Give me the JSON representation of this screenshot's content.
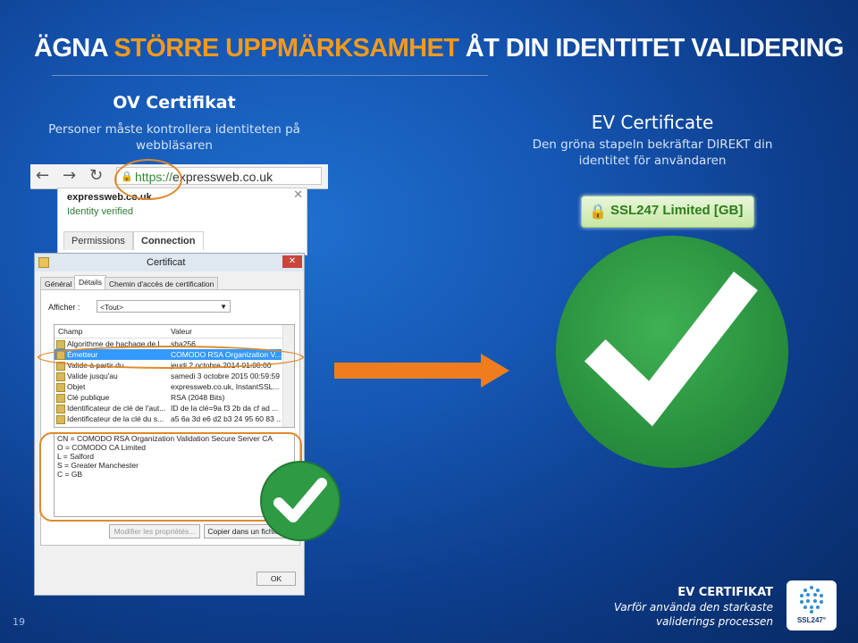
{
  "slide": {
    "title_part1": "ÄGNA ",
    "title_part2": "STÖRRE UPPMÄRKSAMHET",
    "title_part3": " ÅT DIN IDENTITET  VALIDERING",
    "page_number": "19"
  },
  "ov": {
    "title": "OV Certifikat",
    "subtitle": "Personer måste kontrollera identiteten på webbläsaren"
  },
  "ev": {
    "title": "EV Certificate",
    "subtitle": "Den gröna stapeln bekräftar DIREKT din identitet för användaren",
    "badge_text": "SSL247 Limited [GB]"
  },
  "browser": {
    "url_scheme": "https://",
    "url_host": "expressweb.co.uk",
    "popup_domain": "expressweb.co.uk",
    "popup_status": "Identity verified",
    "popup_tabs": [
      "Permissions",
      "Connection"
    ]
  },
  "certificate_dialog": {
    "title": "Certificat",
    "tabs": [
      "Général",
      "Détails",
      "Chemin d'accès de certification"
    ],
    "show_label": "Afficher :",
    "show_value": "<Tout>",
    "col_field": "Champ",
    "col_value": "Valeur",
    "rows": [
      {
        "field": "Algorithme de hachage de l...",
        "value": "sha256"
      },
      {
        "field": "Émetteur",
        "value": "COMODO RSA Organization V..."
      },
      {
        "field": "Valide à partir du",
        "value": "jeudi 2 octobre 2014 01:00:00"
      },
      {
        "field": "Valide jusqu'au",
        "value": "samedi 3 octobre 2015 00:59:59"
      },
      {
        "field": "Objet",
        "value": "expressweb.co.uk, InstantSSL..."
      },
      {
        "field": "Clé publique",
        "value": "RSA (2048 Bits)"
      },
      {
        "field": "Identificateur de clé de l'aut...",
        "value": "ID de la clé=9a f3 2b da cf ad ..."
      },
      {
        "field": "Identificateur de la clé du s...",
        "value": "a5 6a 3d e6 d2 b3 24 95 60 83 ..."
      }
    ],
    "detail_lines": [
      "CN = COMODO RSA Organization Validation Secure Server CA",
      "O = COMODO CA Limited",
      "L = Salford",
      "S = Greater Manchester",
      "C = GB"
    ],
    "edit_properties_button": "Modifier les propriétés...",
    "copy_button": "Copier dans un fichier...",
    "ok_button": "OK"
  },
  "footer": {
    "title": "EV CERTIFIKAT",
    "line1": "Varför använda den starkaste",
    "line2": "validerings processen",
    "logo_text": "SSL247°"
  },
  "colors": {
    "accent_orange": "#f39a1c",
    "check_green": "#2e9a44"
  }
}
